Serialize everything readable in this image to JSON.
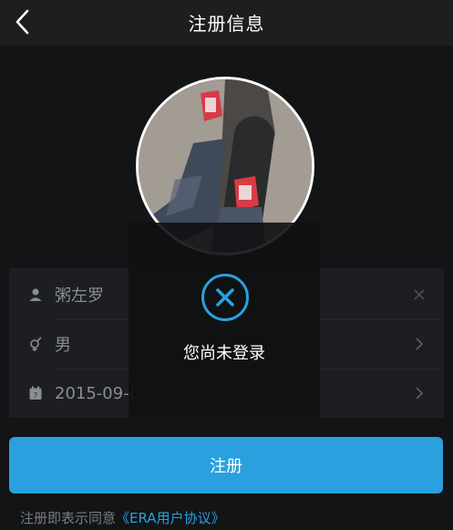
{
  "header": {
    "title": "注册信息",
    "back_icon": "chevron-left-icon"
  },
  "form": {
    "nickname": {
      "value": "粥左罗",
      "icon": "user-icon",
      "action_icon": "clear-x-icon"
    },
    "gender": {
      "value": "男",
      "icon": "gender-icon",
      "action_icon": "chevron-right-icon"
    },
    "birthday": {
      "value": "2015-09-(",
      "icon": "calendar-icon",
      "action_icon": "chevron-right-icon"
    }
  },
  "toast": {
    "message": "您尚未登录",
    "icon": "x-circle-icon"
  },
  "register_button": {
    "label": "注册"
  },
  "agreement": {
    "prefix": "注册即表示同意",
    "link": "《ERA用户协议》"
  },
  "colors": {
    "accent": "#2aa0df",
    "background": "#121416",
    "panel": "#1c1e21"
  }
}
